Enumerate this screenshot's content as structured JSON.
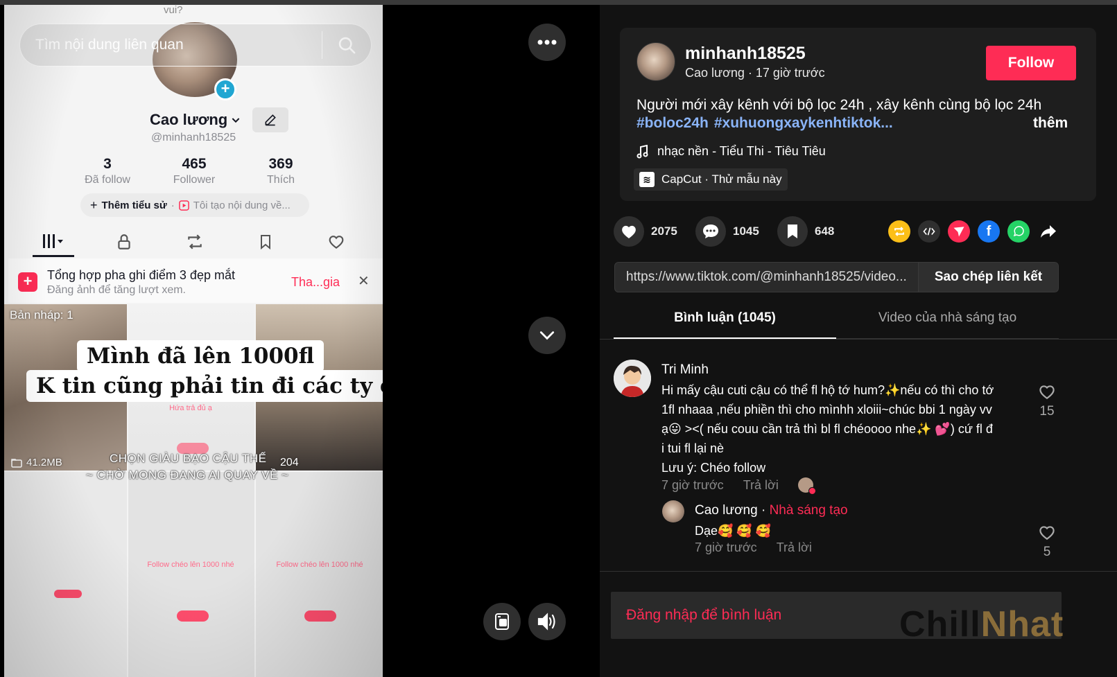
{
  "video": {
    "top_fragment_1": "vui?",
    "search_placeholder": "Tìm nội dung liên quan",
    "profile": {
      "name": "Cao lương",
      "handle": "@minhanh18525",
      "stats": [
        {
          "value": "3",
          "label": "Đã follow"
        },
        {
          "value": "465",
          "label": "Follower"
        },
        {
          "value": "369",
          "label": "Thích"
        }
      ],
      "bio_add": "Thêm tiểu sử",
      "bio_create": "Tôi tạo nội dung về..."
    },
    "promo": {
      "title": "Tổng hợp pha ghi điểm 3 đẹp mắt",
      "subtitle": "Đăng ảnh để tăng lượt xem.",
      "join": "Tha...gia"
    },
    "grid": {
      "draft_label": "Bản nháp: 1",
      "size_label": "41.2MB",
      "views_label": "204"
    },
    "captions": {
      "line1": "Mình đã lên 1000fl",
      "line2": "K tin cũng phải tin đi các ty ơi"
    },
    "lyrics": {
      "line1": "CHỌN GIÀU BẠO CẬU THẾ",
      "line2": "~ CHỜ MONG ĐANG AI QUAY VỀ ~"
    }
  },
  "post": {
    "author": "minhanh18525",
    "author_meta": "Cao lương · 17 giờ trước",
    "follow_label": "Follow",
    "description": "Người mới xây kênh với bộ lọc 24h , xây kênh cùng bộ lọc 24h",
    "hashtags": [
      "#boloc24h",
      "#xuhuongxaykenhtiktok..."
    ],
    "more_label": "thêm",
    "music": "nhạc nền - Tiểu Thi - Tiêu Tiêu",
    "capcut": "CapCut · Thử mẫu này"
  },
  "actions": {
    "likes": "2075",
    "comments": "1045",
    "saves": "648"
  },
  "link": {
    "url": "https://www.tiktok.com/@minhanh18525/video...",
    "copy_label": "Sao chép liên kết"
  },
  "tabs": {
    "comments": "Bình luận (1045)",
    "creator_videos": "Video của nhà sáng tạo"
  },
  "comments": [
    {
      "author": "Tri Minh",
      "lines": [
        "Hi mấy cậu cuti cậu có thể fl hộ tớ hum?✨nếu có thì cho tớ",
        "1fl nhaaa ,nếu phiền thì cho mìnhh xloiii~chúc bbi 1 ngày vv",
        "ạ😛 ><( nếu couu cần trả thì bl fl chéoooo nhe✨ 💕) cứ fl đ",
        "i tui fl lại nè",
        "Lưu ý: Chéo follow"
      ],
      "time": "7 giờ trước",
      "reply": "Trả lời",
      "likes": "15"
    },
    {
      "author": "Cao lương",
      "badge": "Nhà sáng tạo",
      "text": "Dạe🥰 🥰 🥰",
      "time": "7 giờ trước",
      "reply": "Trả lời",
      "likes": "5"
    }
  ],
  "login_prompt": "Đăng nhập để bình luận",
  "watermark": {
    "part1": "Chill",
    "part2": "Nhat"
  },
  "colors": {
    "accent": "#fe2c55",
    "hashtag": "#8ab4f8",
    "panel_bg": "#121212",
    "card_bg": "#1e1e1e"
  }
}
